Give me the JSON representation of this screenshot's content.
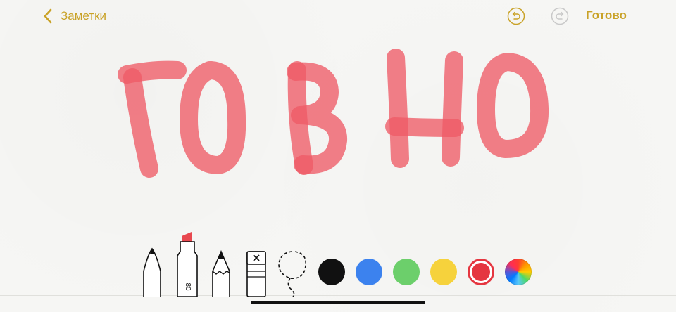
{
  "colors": {
    "accent": "#c9a227",
    "ink": "#ee5b66",
    "black": "#111111",
    "blue": "#3c82ee",
    "green": "#6ccf6b",
    "yellow": "#f6d23c",
    "red": "#e53640"
  },
  "header": {
    "back_label": "Заметки",
    "back_icon": "chevron-left-icon",
    "undo_icon": "undo-icon",
    "redo_icon": "redo-icon",
    "done_label": "Готово"
  },
  "toolbar": {
    "tools": [
      {
        "name": "pen-tool",
        "icon": "pen-icon"
      },
      {
        "name": "marker-tool",
        "icon": "marker-icon",
        "label": "80"
      },
      {
        "name": "pencil-tool",
        "icon": "pencil-icon"
      },
      {
        "name": "eraser-tool",
        "icon": "eraser-icon"
      },
      {
        "name": "lasso-tool",
        "icon": "lasso-icon"
      }
    ],
    "swatches": [
      "black",
      "blue",
      "green",
      "yellow",
      "red",
      "color-wheel"
    ],
    "selected_swatch": "red"
  }
}
